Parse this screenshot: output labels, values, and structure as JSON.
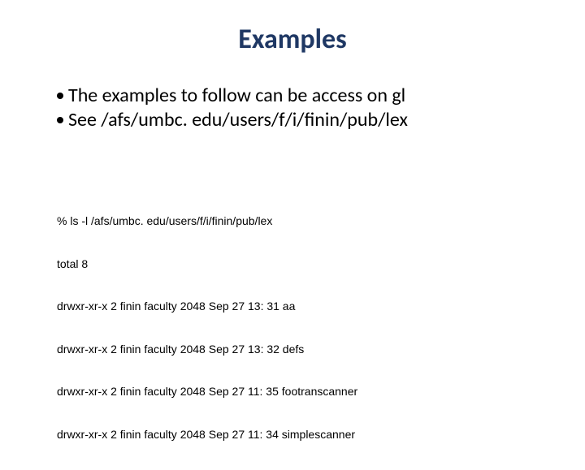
{
  "title": "Examples",
  "bullets": [
    "The examples to follow can be access on gl",
    "See /afs/umbc. edu/users/f/i/finin/pub/lex"
  ],
  "listing": {
    "cmd": "% ls -l /afs/umbc. edu/users/f/i/finin/pub/lex",
    "total": "total 8",
    "rows": [
      "drwxr-xr-x 2 finin faculty 2048 Sep 27 13: 31 aa",
      "drwxr-xr-x 2 finin faculty 2048 Sep 27 13: 32 defs",
      "drwxr-xr-x 2 finin faculty 2048 Sep 27 11: 35 footranscanner",
      "drwxr-xr-x 2 finin faculty 2048 Sep 27 11: 34 simplescanner"
    ]
  }
}
